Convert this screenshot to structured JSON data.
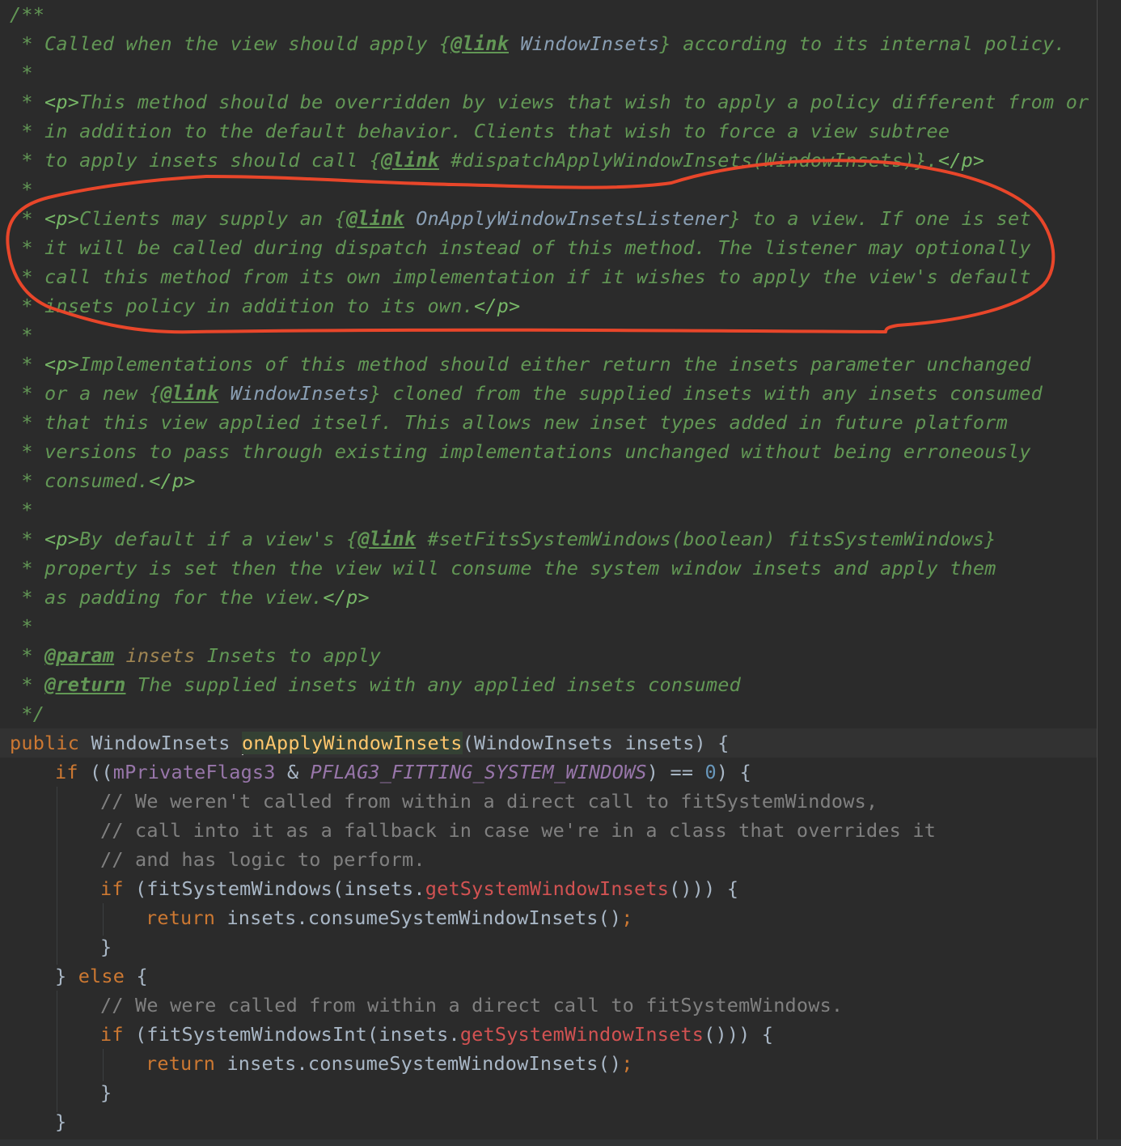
{
  "annotation_color": "#e8462a",
  "colors": {
    "background": "#2b2b2b",
    "javadoc": "#629755",
    "keyword": "#cc7832",
    "method_declaration": "#ffc66d",
    "field": "#9876aa",
    "number": "#6897bb",
    "comment": "#808080",
    "identifier": "#a9b7c6"
  },
  "code": {
    "doc": {
      "open": "/**",
      "star": " * ",
      "star_only": " *",
      "close": " */",
      "l1": "Called when the view should apply {",
      "l1_link": "@link",
      "l1_ref": " WindowInsets",
      "l1_end": "} according to its internal policy.",
      "p_open": "<p>",
      "p_close": "</p>",
      "l3": "This method should be overridden by views that wish to apply a policy different from or",
      "l4": "in addition to the default behavior. Clients that wish to force a view subtree",
      "l5a": "to apply insets should call {",
      "l5_link": "@link",
      "l5_ref": " #dispatchApplyWindowInsets(WindowInsets)",
      "l5b": "}.",
      "l7a": "Clients may supply an {",
      "l7_link": "@link",
      "l7_ref": " OnApplyWindowInsetsListener",
      "l7b": "} to a view. If one is set",
      "l8": "it will be called during dispatch instead of this method. The listener may optionally",
      "l9": "call this method from its own implementation if it wishes to apply the view's default",
      "l10": "insets policy in addition to its own.",
      "l12": "Implementations of this method should either return the insets parameter unchanged",
      "l13a": "or a new {",
      "l13_link": "@link",
      "l13_ref": " WindowInsets",
      "l13b": "} cloned from the supplied insets with any insets consumed",
      "l14": "that this view applied itself. This allows new inset types added in future platform",
      "l15": "versions to pass through existing implementations unchanged without being erroneously",
      "l16": "consumed.",
      "l18a": "By default if a view's {",
      "l18_link": "@link",
      "l18_ref": " #setFitsSystemWindows(boolean) fitsSystemWindows",
      "l18b": "}",
      "l19": "property is set then the view will consume the system window insets and apply them",
      "l20": "as padding for the view.",
      "param_tag": "@param",
      "param_name": " insets",
      "param_desc": " Insets to apply",
      "return_tag": "@return",
      "return_desc": " The supplied insets with any applied insets consumed"
    },
    "sig": {
      "kw_public": "public",
      "type": " WindowInsets ",
      "method": "onApplyWindowInsets",
      "params": "(WindowInsets insets) {"
    },
    "body": {
      "if_kw": "if",
      "if1_a": " ((",
      "if1_field": "mPrivateFlags3",
      "if1_b": " & ",
      "if1_const": "PFLAG3_FITTING_SYSTEM_WINDOWS",
      "if1_c": ") == ",
      "if1_num": "0",
      "if1_d": ") {",
      "c1": "// We weren't called from within a direct call to fitSystemWindows,",
      "c2": "// call into it as a fallback in case we're in a class that overrides it",
      "c3": "// and has logic to perform.",
      "if2_a": " (fitSystemWindows(insets.",
      "get_insets": "getSystemWindowInsets",
      "if2_b": "())) {",
      "return_kw": "return",
      "ret_expr": " insets.consumeSystemWindowInsets()",
      "semi": ";",
      "close_brace": "}",
      "else_a": "} ",
      "else_kw": "else",
      "else_b": " {",
      "c4": "// We were called from within a direct call to fitSystemWindows.",
      "if3_a": " (fitSystemWindowsInt(insets.",
      "if3_b": "())) {"
    }
  }
}
